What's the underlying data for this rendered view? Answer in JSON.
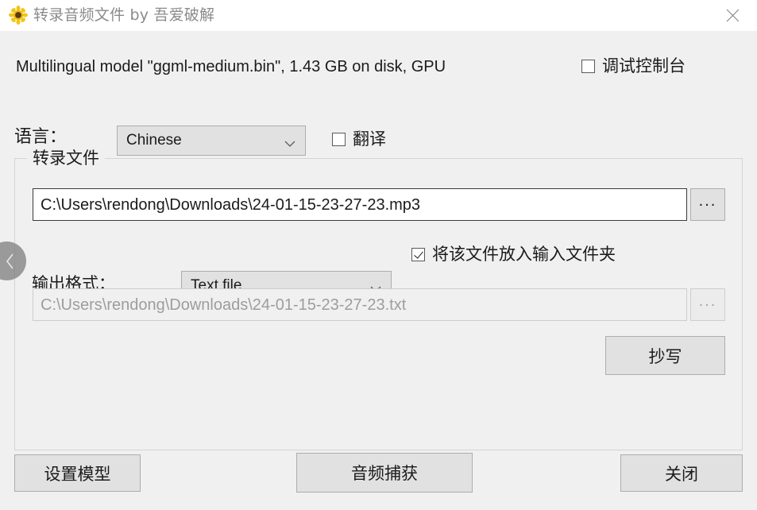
{
  "window": {
    "title": "转录音频文件 by 吾爱破解",
    "app_icon": "sunflower-icon",
    "close_icon": "close-icon",
    "background_color": "#f0f0f0",
    "titlebar_color": "#ffffff"
  },
  "model": {
    "info_line": "Multilingual model \"ggml-medium.bin\", 1.43 GB on disk, GPU"
  },
  "debug_console": {
    "label": "调试控制台",
    "checked": false
  },
  "language": {
    "label": "语言：",
    "selected": "Chinese",
    "options": [
      "Chinese"
    ],
    "arrow_icon": "chevron-down-icon"
  },
  "translate": {
    "label": "翻译",
    "checked": false
  },
  "group": {
    "title": "转录文件"
  },
  "input_file": {
    "value": "C:\\Users\\rendong\\Downloads\\24-01-15-23-27-23.mp3",
    "placeholder": "",
    "browse_label": "...",
    "browse_icon": "ellipsis-icon"
  },
  "output_format": {
    "label": "输出格式：",
    "selected": "Text file",
    "options": [
      "Text file"
    ],
    "arrow_icon": "chevron-down-icon"
  },
  "put_in_input_folder": {
    "label": "将该文件放入输入文件夹",
    "checked": true
  },
  "output_file": {
    "value": "C:\\Users\\rendong\\Downloads\\24-01-15-23-27-23.txt",
    "placeholder": "",
    "browse_label": "...",
    "browse_icon": "ellipsis-icon",
    "disabled": true
  },
  "buttons": {
    "transcribe": "抄写",
    "set_model": "设置模型",
    "audio_capture": "音频捕获",
    "close": "关闭"
  },
  "collapse_handle": {
    "icon": "chevron-left-icon"
  },
  "colors": {
    "text": "#1b1b1b",
    "title_text": "#8b8b8b",
    "disabled_text": "#9d9d9d",
    "button_face": "#e1e1e1",
    "button_border": "#adadad",
    "field_border": "#3b3b3b",
    "group_border": "#d4d4d4",
    "icon_petal": "#f5c518",
    "icon_center": "#5a3a18",
    "handle": "rgba(130,130,130,0.78)"
  }
}
